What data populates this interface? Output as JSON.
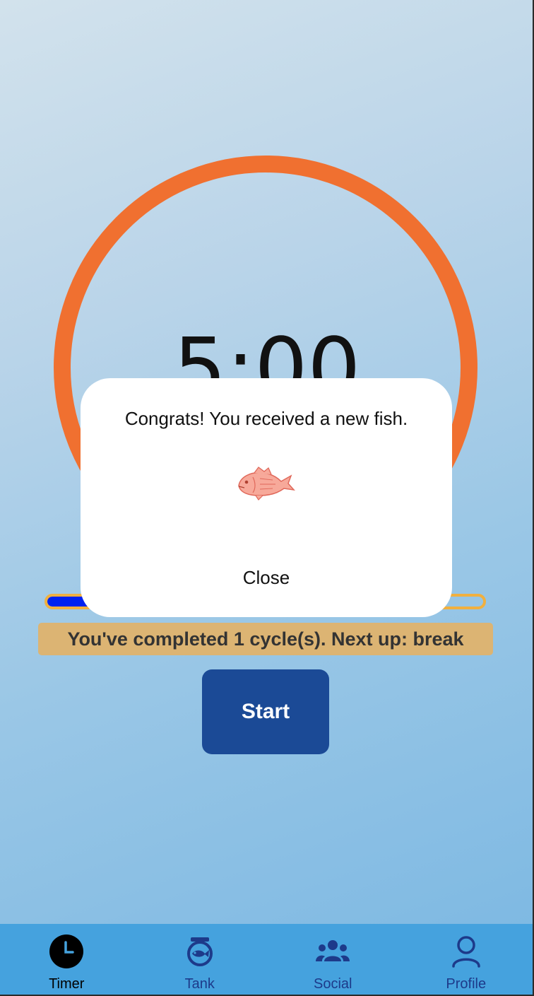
{
  "timer": {
    "time": "5:00",
    "progress_fraction": 0.12
  },
  "status": {
    "cycle_message": "You've completed 1 cycle(s). Next up: break"
  },
  "controls": {
    "start_label": "Start"
  },
  "modal": {
    "message": "Congrats! You received a new fish.",
    "close_label": "Close",
    "reward_icon": "fish-icon"
  },
  "tab_bar": {
    "items": [
      {
        "label": "Timer",
        "icon": "clock-icon",
        "active": true
      },
      {
        "label": "Tank",
        "icon": "fishbowl-icon",
        "active": false
      },
      {
        "label": "Social",
        "icon": "people-icon",
        "active": false
      },
      {
        "label": "Profile",
        "icon": "person-icon",
        "active": false
      }
    ]
  },
  "colors": {
    "ring": "#f07030",
    "progress_fill": "#0022f0",
    "progress_track_border": "#f0b040",
    "banner": "#dcb473",
    "start_button": "#1b4a96",
    "tab_bar": "#45a2de",
    "tab_icon": "#1d3a8a"
  }
}
